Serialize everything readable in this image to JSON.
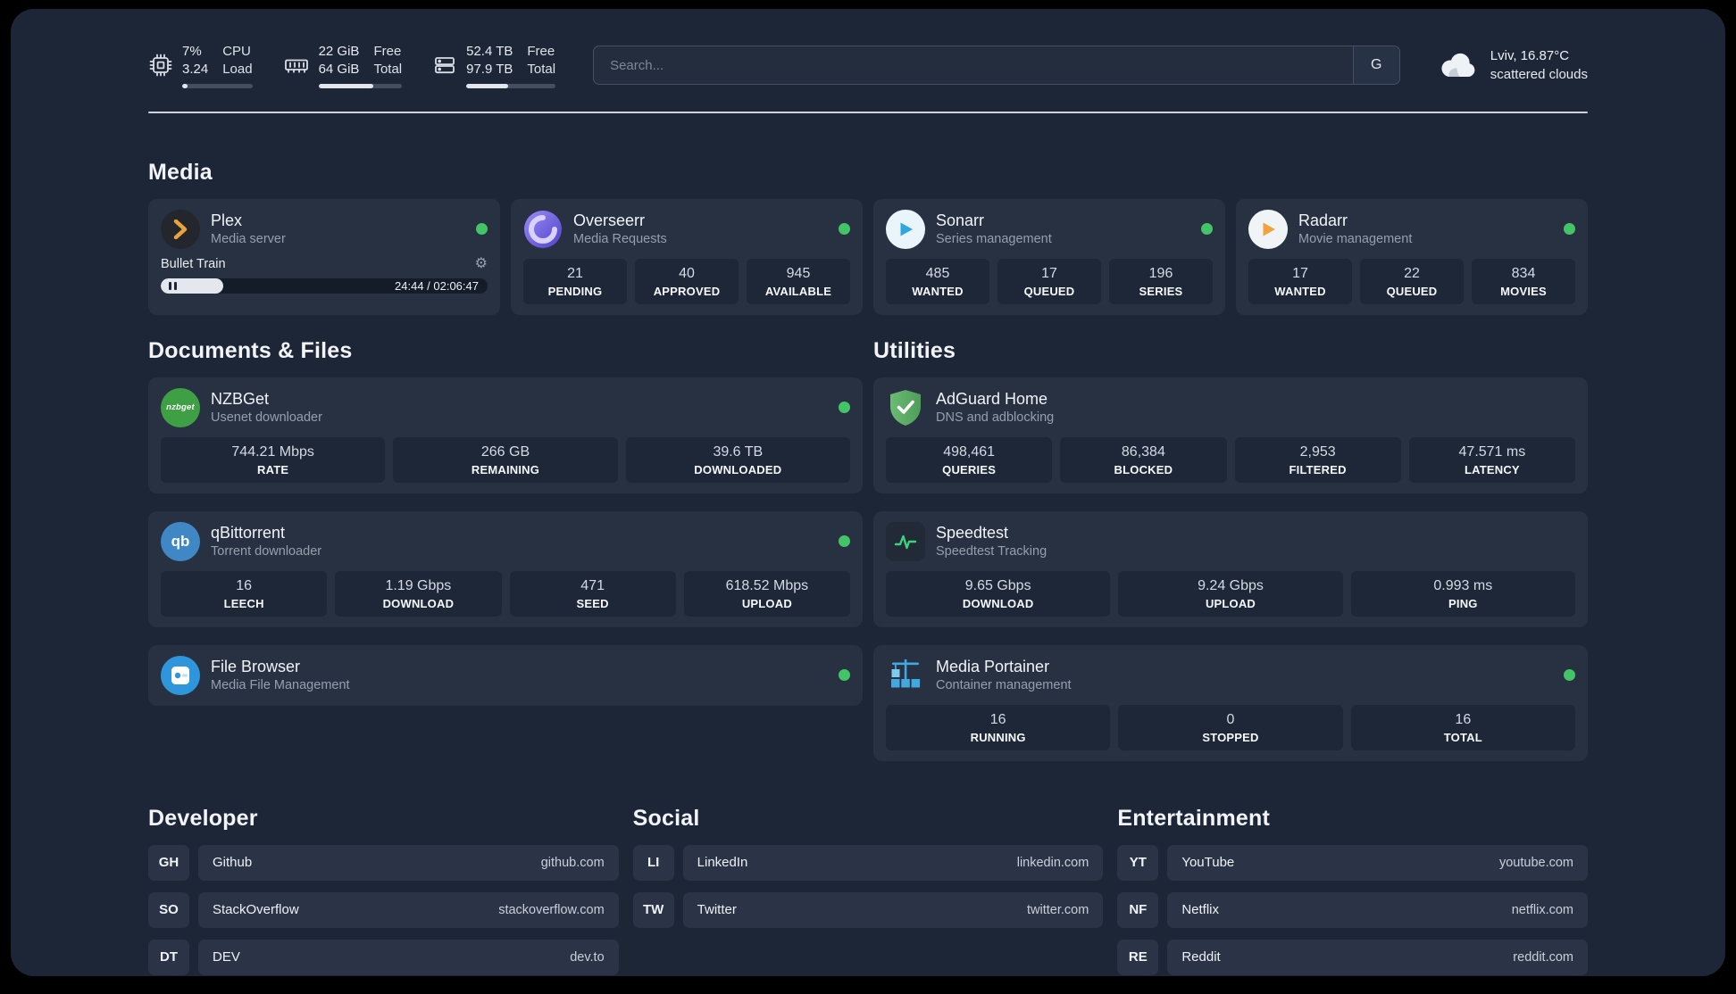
{
  "colors": {
    "status_online": "#43c466",
    "page_bg": "#1d2636",
    "card_bg": "#283142",
    "tile_bg": "#1e2737",
    "accent_plex": "#e8a33d",
    "accent_sonarr": "#2ea6e0",
    "accent_radarr": "#f0a23c",
    "accent_adguard": "#5cb167",
    "accent_portainer": "#41a8e0",
    "accent_speedtest": "#3ed07e"
  },
  "topbar": {
    "cpu": {
      "values": [
        "7%",
        "3.24"
      ],
      "labels": [
        "CPU",
        "Load"
      ],
      "usage_pct": 7
    },
    "memory": {
      "values": [
        "22 GiB",
        "64 GiB"
      ],
      "labels": [
        "Free",
        "Total"
      ],
      "usage_pct": 66
    },
    "disk": {
      "values": [
        "52.4 TB",
        "97.9 TB"
      ],
      "labels": [
        "Free",
        "Total"
      ],
      "usage_pct": 47
    },
    "search": {
      "placeholder": "Search...",
      "engine_label": "G"
    },
    "weather": {
      "location": "Lviv, 16.87°C",
      "condition": "scattered clouds"
    }
  },
  "sections": {
    "media": "Media",
    "documents": "Documents & Files",
    "utilities": "Utilities",
    "developer": "Developer",
    "social": "Social",
    "entertainment": "Entertainment"
  },
  "icons": {
    "gear": "⚙",
    "pause": "❚❚",
    "status_dot": "●"
  },
  "apps": {
    "plex": {
      "name": "Plex",
      "subtitle": "Media server",
      "now_playing": "Bullet Train",
      "time": "24:44 / 02:06:47",
      "progress_pct": 19
    },
    "overseerr": {
      "name": "Overseerr",
      "subtitle": "Media Requests",
      "stats": [
        {
          "value": "21",
          "label": "PENDING"
        },
        {
          "value": "40",
          "label": "APPROVED"
        },
        {
          "value": "945",
          "label": "AVAILABLE"
        }
      ]
    },
    "sonarr": {
      "name": "Sonarr",
      "subtitle": "Series management",
      "stats": [
        {
          "value": "485",
          "label": "WANTED"
        },
        {
          "value": "17",
          "label": "QUEUED"
        },
        {
          "value": "196",
          "label": "SERIES"
        }
      ]
    },
    "radarr": {
      "name": "Radarr",
      "subtitle": "Movie management",
      "stats": [
        {
          "value": "17",
          "label": "WANTED"
        },
        {
          "value": "22",
          "label": "QUEUED"
        },
        {
          "value": "834",
          "label": "MOVIES"
        }
      ]
    },
    "nzbget": {
      "name": "NZBGet",
      "subtitle": "Usenet downloader",
      "icon_text": "nzbget",
      "stats": [
        {
          "value": "744.21 Mbps",
          "label": "RATE"
        },
        {
          "value": "266 GB",
          "label": "REMAINING"
        },
        {
          "value": "39.6 TB",
          "label": "DOWNLOADED"
        }
      ]
    },
    "qbittorrent": {
      "name": "qBittorrent",
      "subtitle": "Torrent downloader",
      "icon_text": "qb",
      "stats": [
        {
          "value": "16",
          "label": "LEECH"
        },
        {
          "value": "1.19 Gbps",
          "label": "DOWNLOAD"
        },
        {
          "value": "471",
          "label": "SEED"
        },
        {
          "value": "618.52 Mbps",
          "label": "UPLOAD"
        }
      ]
    },
    "filebrowser": {
      "name": "File Browser",
      "subtitle": "Media File Management"
    },
    "adguard": {
      "name": "AdGuard Home",
      "subtitle": "DNS and adblocking",
      "stats": [
        {
          "value": "498,461",
          "label": "QUERIES"
        },
        {
          "value": "86,384",
          "label": "BLOCKED"
        },
        {
          "value": "2,953",
          "label": "FILTERED"
        },
        {
          "value": "47.571 ms",
          "label": "LATENCY"
        }
      ]
    },
    "speedtest": {
      "name": "Speedtest",
      "subtitle": "Speedtest Tracking",
      "stats": [
        {
          "value": "9.65 Gbps",
          "label": "DOWNLOAD"
        },
        {
          "value": "9.24 Gbps",
          "label": "UPLOAD"
        },
        {
          "value": "0.993 ms",
          "label": "PING"
        }
      ]
    },
    "portainer": {
      "name": "Media Portainer",
      "subtitle": "Container management",
      "stats": [
        {
          "value": "16",
          "label": "RUNNING"
        },
        {
          "value": "0",
          "label": "STOPPED"
        },
        {
          "value": "16",
          "label": "TOTAL"
        }
      ]
    }
  },
  "links": {
    "developer": [
      {
        "abbr": "GH",
        "name": "Github",
        "url": "github.com"
      },
      {
        "abbr": "SO",
        "name": "StackOverflow",
        "url": "stackoverflow.com"
      },
      {
        "abbr": "DT",
        "name": "DEV",
        "url": "dev.to"
      }
    ],
    "social": [
      {
        "abbr": "LI",
        "name": "LinkedIn",
        "url": "linkedin.com"
      },
      {
        "abbr": "TW",
        "name": "Twitter",
        "url": "twitter.com"
      }
    ],
    "entertainment": [
      {
        "abbr": "YT",
        "name": "YouTube",
        "url": "youtube.com"
      },
      {
        "abbr": "NF",
        "name": "Netflix",
        "url": "netflix.com"
      },
      {
        "abbr": "RE",
        "name": "Reddit",
        "url": "reddit.com"
      }
    ]
  }
}
